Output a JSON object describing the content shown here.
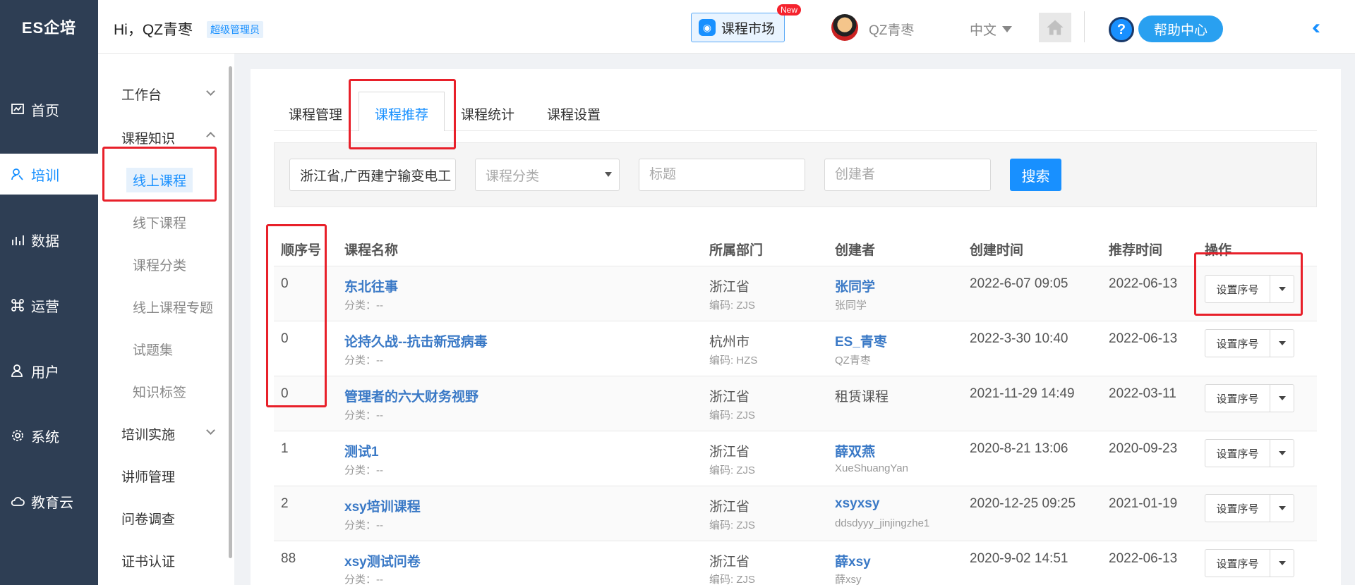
{
  "app": {
    "logo": "ES企培"
  },
  "header": {
    "greeting": "Hi，QZ青枣",
    "role": "超级管理员",
    "market_label": "课程市场",
    "new_badge": "New",
    "username": "QZ青枣",
    "language": "中文",
    "help_label": "帮助中心",
    "help_icon": "?"
  },
  "nav": {
    "items": [
      {
        "label": "首页",
        "icon": "chart-icon"
      },
      {
        "label": "培训",
        "icon": "training-icon",
        "active": true
      },
      {
        "label": "数据",
        "icon": "bar-chart-icon"
      },
      {
        "label": "运营",
        "icon": "command-icon"
      },
      {
        "label": "用户",
        "icon": "user-icon"
      },
      {
        "label": "系统",
        "icon": "gear-icon"
      },
      {
        "label": "教育云",
        "icon": "cloud-icon"
      }
    ]
  },
  "subnav": {
    "items": [
      {
        "label": "工作台"
      },
      {
        "label": "课程知识"
      },
      {
        "label": "线上课程",
        "active": true
      },
      {
        "label": "线下课程"
      },
      {
        "label": "课程分类"
      },
      {
        "label": "线上课程专题"
      },
      {
        "label": "试题集"
      },
      {
        "label": "知识标签"
      },
      {
        "label": "培训实施"
      },
      {
        "label": "讲师管理"
      },
      {
        "label": "问卷调查"
      },
      {
        "label": "证书认证"
      }
    ]
  },
  "tabs": [
    {
      "label": "课程管理"
    },
    {
      "label": "课程推荐",
      "active": true
    },
    {
      "label": "课程统计"
    },
    {
      "label": "课程设置"
    }
  ],
  "filters": {
    "dept_value": "浙江省,广西建宁输变电工",
    "category_placeholder": "课程分类",
    "title_placeholder": "标题",
    "creator_placeholder": "创建者",
    "search_label": "搜索"
  },
  "table": {
    "headers": [
      "顺序号",
      "课程名称",
      "所属部门",
      "创建者",
      "创建时间",
      "推荐时间",
      "操作"
    ],
    "op_label": "设置序号",
    "rows": [
      {
        "seq": "0",
        "name": "东北往事",
        "category": "分类：--",
        "dept": "浙江省",
        "code": "编码: ZJS",
        "creator": "张同学",
        "creator_link": true,
        "creator_sub": "张同学",
        "created": "2022-6-07 09:05",
        "recommended": "2022-06-13"
      },
      {
        "seq": "0",
        "name": "论持久战--抗击新冠病毒",
        "category": "分类：--",
        "dept": "杭州市",
        "code": "编码: HZS",
        "creator": "ES_青枣",
        "creator_link": true,
        "creator_sub": "QZ青枣",
        "created": "2022-3-30 10:40",
        "recommended": "2022-06-13"
      },
      {
        "seq": "0",
        "name": "管理者的六大财务视野",
        "category": "分类：--",
        "dept": "浙江省",
        "code": "编码: ZJS",
        "creator": "租赁课程",
        "creator_link": false,
        "creator_sub": "",
        "created": "2021-11-29 14:49",
        "recommended": "2022-03-11"
      },
      {
        "seq": "1",
        "name": "测试1",
        "category": "分类：--",
        "dept": "浙江省",
        "code": "编码: ZJS",
        "creator": "薛双燕",
        "creator_link": true,
        "creator_sub": "XueShuangYan",
        "created": "2020-8-21 13:06",
        "recommended": "2020-09-23"
      },
      {
        "seq": "2",
        "name": "xsy培训课程",
        "category": "分类：--",
        "dept": "浙江省",
        "code": "编码: ZJS",
        "creator": "xsyxsy",
        "creator_link": true,
        "creator_sub": "ddsdyyy_jinjingzhe1",
        "created": "2020-12-25 09:25",
        "recommended": "2021-01-19"
      },
      {
        "seq": "88",
        "name": "xsy测试问卷",
        "category": "分类：--",
        "dept": "浙江省",
        "code": "编码: ZJS",
        "creator": "薛xsy",
        "creator_link": true,
        "creator_sub": "薛xsy",
        "created": "2020-9-02 14:51",
        "recommended": "2022-06-13"
      }
    ]
  },
  "colors": {
    "sidebar": "#2e3e54",
    "accent": "#1890ff",
    "annotation": "#e8202a",
    "link": "#3a79c6"
  }
}
